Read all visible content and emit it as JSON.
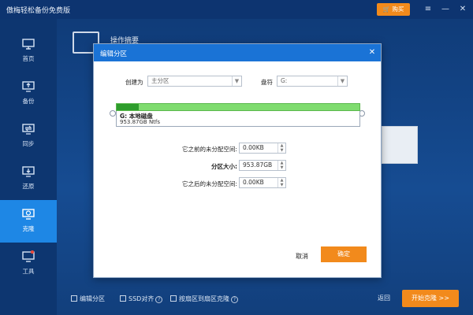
{
  "app": {
    "title": "傲梅轻松备份免费版",
    "buy_label": "购买"
  },
  "window_controls": {
    "menu": "≡",
    "minimize": "—",
    "close": "✕"
  },
  "sidebar": {
    "items": [
      {
        "label": "首页",
        "icon": "home-icon"
      },
      {
        "label": "备份",
        "icon": "backup-icon"
      },
      {
        "label": "同步",
        "icon": "sync-icon"
      },
      {
        "label": "还原",
        "icon": "restore-icon"
      },
      {
        "label": "克隆",
        "icon": "clone-icon",
        "active": true
      },
      {
        "label": "工具",
        "icon": "tools-icon"
      }
    ]
  },
  "content": {
    "header_text": "操作摘要"
  },
  "dialog": {
    "title": "编辑分区",
    "create_as_label": "创建为",
    "create_as_value": "主分区",
    "drive_letter_label": "盘符",
    "drive_letter_value": "G:",
    "partition": {
      "name": "G: 本地磁盘",
      "size": "953.87GB Ntfs",
      "used_fraction": 0.09
    },
    "fields": [
      {
        "label": "它之前的未分配空间:",
        "value": "0.00KB",
        "bold": false
      },
      {
        "label": "分区大小:",
        "value": "953.87GB",
        "bold": true
      },
      {
        "label": "它之后的未分配空间:",
        "value": "0.00KB",
        "bold": false
      }
    ],
    "cancel_label": "取消",
    "ok_label": "确定"
  },
  "bottom": {
    "edit_partition": "编辑分区",
    "ssd_align": "SSD对齐",
    "sector_clone": "按扇区到扇区克隆",
    "back_label": "返回",
    "start_label": "开始克隆 >>"
  },
  "colors": {
    "accent": "#1a73d6",
    "orange": "#f28a1c",
    "sidebar_active": "#1e87e5"
  }
}
